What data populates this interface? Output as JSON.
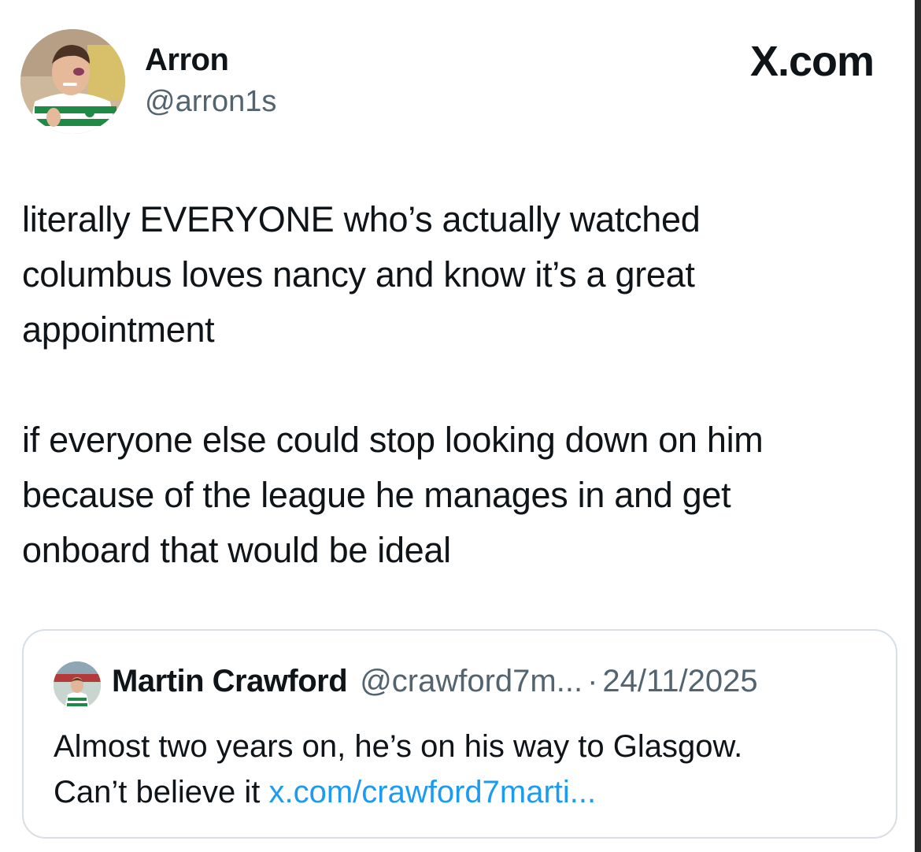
{
  "author": {
    "name": "Arron",
    "handle": "@arron1s",
    "avatar_icon": "profile-photo-avatar"
  },
  "brand": {
    "icon": "x-logo-icon",
    "text": "X.com"
  },
  "tweet": {
    "paragraphs": [
      "literally EVERYONE who’s actually watched\ncolumbus loves nancy and know it’s a great\nappointment",
      "if everyone else could stop looking down on him\nbecause of the league he manages in and get\nonboard that would be ideal"
    ]
  },
  "quote": {
    "name": "Martin Crawford",
    "handle": "@crawford7m...",
    "separator": "·",
    "date": "24/11/2025",
    "text_line1": "Almost two years on, he’s on his way to Glasgow.",
    "text_line2": "Can’t believe it ",
    "link": "x.com/crawford7marti..."
  },
  "colors": {
    "text": "#0f1419",
    "secondary": "#536471",
    "link": "#1d9bf0",
    "border": "#d8dee3"
  }
}
